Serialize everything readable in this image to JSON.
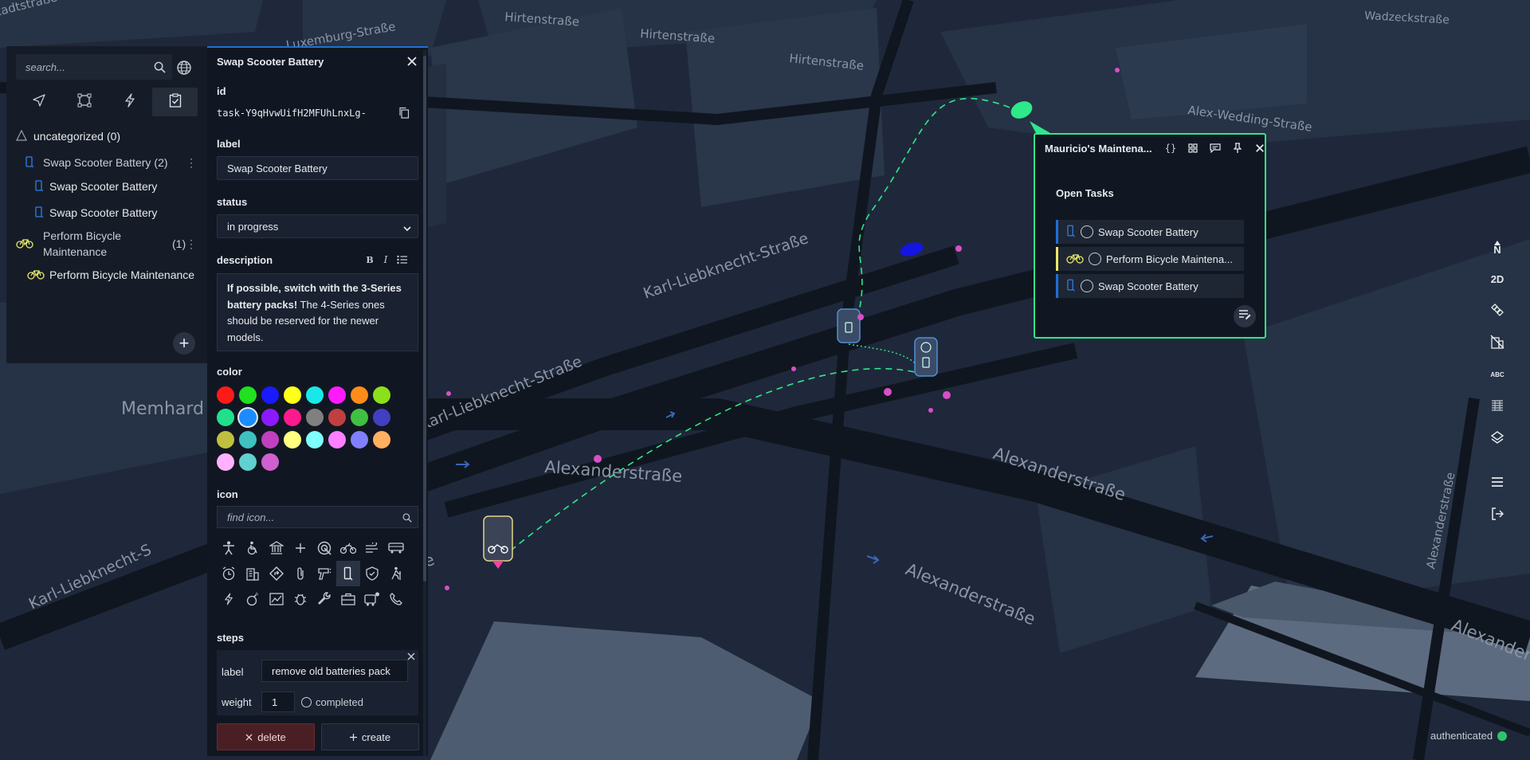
{
  "map": {
    "street_labels": [
      "Hirtenstraße",
      "Hirtenstraße",
      "Hirtenstraße",
      "Luxemburg-Straße",
      "Wadzeckstraße",
      "Alex-Wedding-Straße",
      "Karl-Liebknecht-Straße",
      "Karl-Liebknecht-Straße",
      "Karl-Liebknecht-S",
      "Alexanderstraße",
      "Alexanderstraße",
      "Alexanderstraße",
      "Alexanderstraße",
      "Alexanderstraße",
      "Alexanderstraße",
      "Memhard",
      "nstadtstraße",
      "e"
    ]
  },
  "search": {
    "placeholder": "search..."
  },
  "icons": {
    "search": "search-icon",
    "globe": "globe-icon",
    "tabs": [
      "navigation-arrow-icon",
      "square-icon",
      "lightning-icon",
      "clipboard-check-icon"
    ]
  },
  "tree": {
    "uncategorized": {
      "label": "uncategorized",
      "count": "(0)"
    },
    "groups": [
      {
        "label": "Swap Scooter Battery",
        "count": "(2)",
        "items": [
          "Swap Scooter Battery",
          "Swap Scooter Battery"
        ]
      },
      {
        "label": "Perform Bicycle Maintenance",
        "label_line1": "Perform Bicycle",
        "label_line2": "Maintenance",
        "count": "(1)",
        "items": [
          "Perform Bicycle Maintenance"
        ]
      }
    ],
    "add_label": "+"
  },
  "edit_panel": {
    "title": "Swap Scooter Battery",
    "id_label": "id",
    "id_value": "task-Y9qHvwUifH2MFUhLnxLg-",
    "label_label": "label",
    "label_value": "Swap Scooter Battery",
    "status_label": "status",
    "status_value": "in progress",
    "description_label": "description",
    "description_bold": "If possible, switch with the 3-Series battery packs!",
    "description_rest": " The 4-Series ones should be reserved for the newer models.",
    "color_label": "color",
    "colors": [
      "#ff1a1a",
      "#20e020",
      "#1a1aff",
      "#ffff1a",
      "#1ae8e8",
      "#ff1aff",
      "#ff8c1a",
      "#8ce01a",
      "#20e08c",
      "#1a8cff",
      "#8c1aff",
      "#ff1a8c",
      "#808080",
      "#c04040",
      "#40c040",
      "#4040c0",
      "#c0c040",
      "#40c0c0",
      "#c040c0",
      "#ffff80",
      "#80ffff",
      "#ff80ff",
      "#8080ff",
      "#ffb060",
      "#ffb0ff",
      "#60d0d0",
      "#d060d0"
    ],
    "selected_color_index": 9,
    "icon_label": "icon",
    "icon_search_placeholder": "find icon...",
    "steps_label": "steps",
    "step": {
      "label_label": "label",
      "label_value": "remove old batteries pack",
      "weight_label": "weight",
      "weight_value": "1",
      "completed_label": "completed"
    },
    "delete_label": "delete",
    "create_label": "create"
  },
  "popup": {
    "title": "Mauricio's Maintena...",
    "open_tasks_title": "Open Tasks",
    "tasks": [
      {
        "label": "Swap Scooter Battery",
        "icon": "scooter-battery-icon",
        "accent": "#1f6fd6"
      },
      {
        "label": "Perform Bicycle Maintena...",
        "icon": "bicycle-icon",
        "accent": "#e8e86a"
      },
      {
        "label": "Swap Scooter Battery",
        "icon": "scooter-battery-icon",
        "accent": "#1f6fd6"
      }
    ]
  },
  "right_toolbar": {
    "north_label": "N",
    "mode_label": "2D",
    "abc_label": "ABC"
  },
  "status": {
    "label": "authenticated",
    "color": "#2ec36b"
  }
}
